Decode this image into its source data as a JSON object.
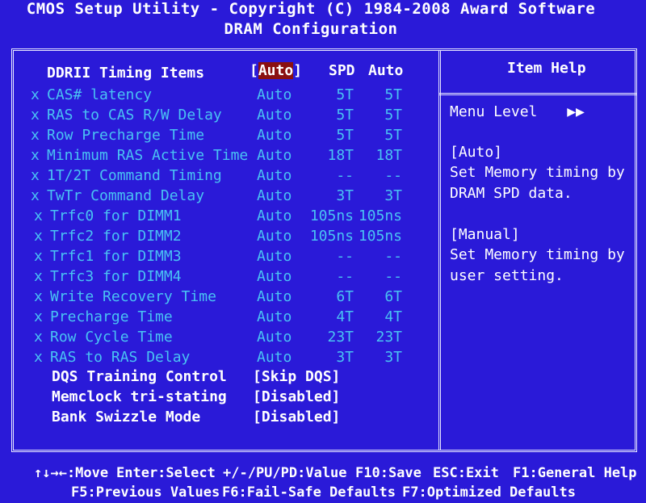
{
  "header": {
    "line1": "CMOS Setup Utility - Copyright (C) 1984-2008 Award Software",
    "line2": "DRAM Configuration"
  },
  "main": {
    "title": "DDRII Timing Items",
    "title_value_bracket_l": "[",
    "title_value": "Auto",
    "title_value_bracket_r": "]",
    "col_spd": "SPD",
    "col_auto": "Auto",
    "rows": [
      {
        "x": "x",
        "label": "CAS# latency",
        "value": "Auto",
        "spd": "5T",
        "auto": "5T"
      },
      {
        "x": "x",
        "label": "RAS to CAS R/W Delay",
        "value": "Auto",
        "spd": "5T",
        "auto": "5T"
      },
      {
        "x": "x",
        "label": "Row Precharge Time",
        "value": "Auto",
        "spd": "5T",
        "auto": "5T"
      },
      {
        "x": "x",
        "label": "Minimum RAS Active Time",
        "value": "Auto",
        "spd": "18T",
        "auto": "18T"
      },
      {
        "x": "x",
        "label": "1T/2T Command Timing",
        "value": "Auto",
        "spd": "--",
        "auto": "--"
      },
      {
        "x": "x",
        "label": "TwTr Command Delay",
        "value": "Auto",
        "spd": "3T",
        "auto": "3T"
      },
      {
        "x": "x",
        "label": "Trfc0 for DIMM1",
        "value": "Auto",
        "spd": "105ns",
        "auto": "105ns"
      },
      {
        "x": "x",
        "label": "Trfc2 for DIMM2",
        "value": "Auto",
        "spd": "105ns",
        "auto": "105ns"
      },
      {
        "x": "x",
        "label": "Trfc1 for DIMM3",
        "value": "Auto",
        "spd": "--",
        "auto": "--"
      },
      {
        "x": "x",
        "label": "Trfc3 for DIMM4",
        "value": "Auto",
        "spd": "--",
        "auto": "--"
      },
      {
        "x": "x",
        "label": "Write Recovery Time",
        "value": "Auto",
        "spd": "6T",
        "auto": "6T"
      },
      {
        "x": "x",
        "label": "Precharge Time",
        "value": "Auto",
        "spd": "4T",
        "auto": "4T"
      },
      {
        "x": "x",
        "label": "Row Cycle Time",
        "value": "Auto",
        "spd": "23T",
        "auto": "23T"
      },
      {
        "x": "x",
        "label": "RAS to RAS Delay",
        "value": "Auto",
        "spd": "3T",
        "auto": "3T"
      }
    ],
    "settings": [
      {
        "label": "DQS Training Control",
        "value": "[Skip DQS]"
      },
      {
        "label": "Memclock tri-stating",
        "value": "[Disabled]"
      },
      {
        "label": "Bank Swizzle Mode",
        "value": "[Disabled]"
      }
    ]
  },
  "help": {
    "title": "Item Help",
    "menu_level": "Menu Level",
    "menu_level_arrows": "▶▶",
    "auto_title": "[Auto]",
    "auto_line1": "Set Memory timing by",
    "auto_line2": "DRAM SPD data.",
    "manual_title": "[Manual]",
    "manual_line1": "Set Memory timing by",
    "manual_line2": "user setting."
  },
  "footer": {
    "line1": [
      "↑↓→←:Move",
      "Enter:Select",
      "+/-/PU/PD:Value",
      "F10:Save",
      "ESC:Exit",
      "F1:General Help"
    ],
    "line2": [
      "F5:Previous Values",
      "F6:Fail-Safe Defaults",
      "F7:Optimized Defaults"
    ]
  },
  "colors": {
    "background": "#2a1ad8",
    "disabled_text": "#49c3f3",
    "active_text": "#ffffff",
    "selection": "#8a1010"
  }
}
